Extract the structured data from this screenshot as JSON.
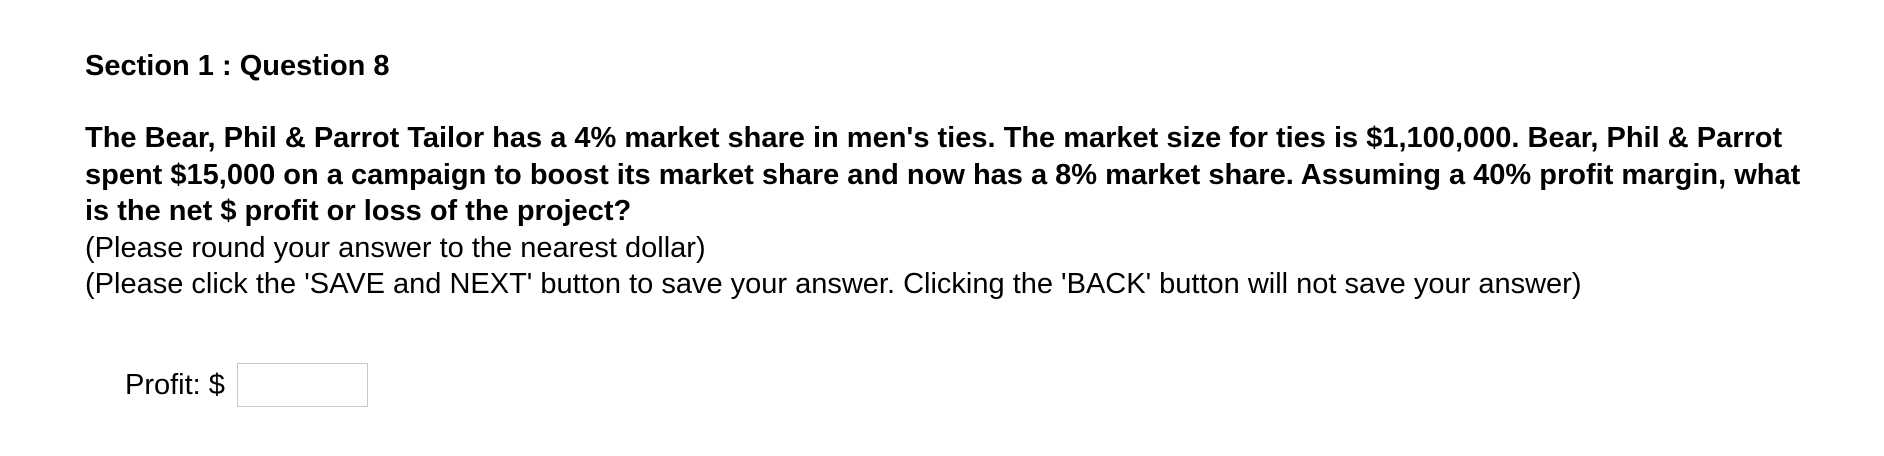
{
  "section": {
    "heading": "Section 1 : Question 8"
  },
  "question": {
    "text": "The Bear, Phil & Parrot Tailor has a 4% market share in men's ties. The market size for ties is $1,100,000. Bear, Phil & Parrot spent $15,000 on a campaign to boost its market share and now has a 8% market share. Assuming a 40% profit margin, what is the net $ profit or loss of the project?",
    "instruction_round": "(Please round your answer to the nearest dollar)",
    "instruction_save": "(Please click the 'SAVE and NEXT' button to save your answer. Clicking the 'BACK' button will not save your answer)"
  },
  "answer": {
    "label": "Profit: $",
    "value": ""
  }
}
